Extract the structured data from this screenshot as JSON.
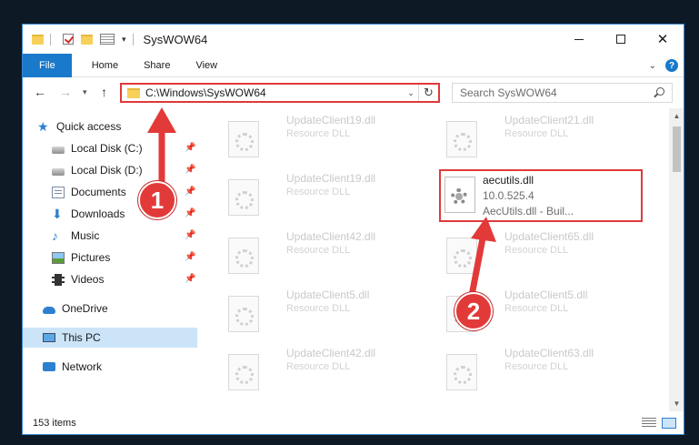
{
  "window": {
    "title": "SysWOW64"
  },
  "ribbon": {
    "tabs": [
      "File",
      "Home",
      "Share",
      "View"
    ]
  },
  "address": {
    "path": "C:\\Windows\\SysWOW64",
    "search_placeholder": "Search SysWOW64"
  },
  "sidebar": {
    "items": [
      {
        "label": "Quick access",
        "icon": "star-icon",
        "pinned": false
      },
      {
        "label": "Local Disk (C:)",
        "icon": "disk-icon",
        "pinned": true
      },
      {
        "label": "Local Disk (D:)",
        "icon": "disk-icon",
        "pinned": true
      },
      {
        "label": "Documents",
        "icon": "documents-icon",
        "pinned": true
      },
      {
        "label": "Downloads",
        "icon": "download-icon",
        "pinned": true
      },
      {
        "label": "Music",
        "icon": "music-icon",
        "pinned": true
      },
      {
        "label": "Pictures",
        "icon": "pictures-icon",
        "pinned": true
      },
      {
        "label": "Videos",
        "icon": "videos-icon",
        "pinned": true
      },
      {
        "label": "OneDrive",
        "icon": "cloud-icon",
        "pinned": false
      },
      {
        "label": "This PC",
        "icon": "pc-icon",
        "pinned": false,
        "selected": true
      },
      {
        "label": "Network",
        "icon": "network-icon",
        "pinned": false
      }
    ]
  },
  "files": [
    {
      "name": "UpdateClient19.dll",
      "desc": "Resource DLL"
    },
    {
      "name": "UpdateClient21.dll",
      "desc": "Resource DLL"
    },
    {
      "name": "UpdateClient19.dll",
      "desc": "Resource DLL"
    },
    {
      "name": "UpdateClient42.dll",
      "desc": "Resource DLL"
    },
    {
      "name": "UpdateClient65.dll",
      "desc": "Resource DLL"
    },
    {
      "name": "UpdateClient5.dll",
      "desc": "Resource DLL"
    },
    {
      "name": "UpdateClient5.dll",
      "desc": "Resource DLL"
    },
    {
      "name": "UpdateClient42.dll",
      "desc": "Resource DLL"
    },
    {
      "name": "UpdateClient63.dll",
      "desc": "Resource DLL"
    }
  ],
  "highlighted_file": {
    "name": "aecutils.dll",
    "version": "10.0.525.4",
    "desc": "AecUtils.dll - Buil..."
  },
  "status": {
    "item_count": "153 items"
  },
  "callouts": [
    "1",
    "2"
  ],
  "colors": {
    "accent": "#1979ca",
    "highlight": "#e0393b",
    "selection": "#cce4f7"
  }
}
